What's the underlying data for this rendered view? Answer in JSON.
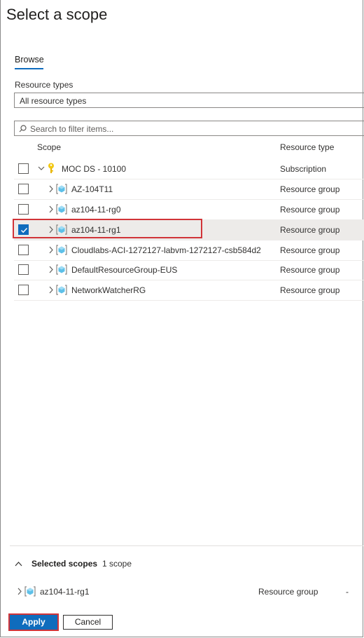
{
  "panel": {
    "title": "Select a scope"
  },
  "tabs": [
    {
      "label": "Browse"
    }
  ],
  "resource_types": {
    "label": "Resource types",
    "value": "All resource types"
  },
  "filter": {
    "placeholder": "Search to filter items..."
  },
  "table": {
    "headers": {
      "scope": "Scope",
      "type": "Resource type"
    },
    "rows": [
      {
        "name": "MOC DS - 10100",
        "type": "Subscription",
        "checked": false,
        "expanded": true,
        "icon": "key-icon"
      },
      {
        "name": "AZ-104T11",
        "type": "Resource group",
        "checked": false,
        "expanded": false,
        "icon": "resource-group-icon"
      },
      {
        "name": "az104-11-rg0",
        "type": "Resource group",
        "checked": false,
        "expanded": false,
        "icon": "resource-group-icon"
      },
      {
        "name": "az104-11-rg1",
        "type": "Resource group",
        "checked": true,
        "expanded": false,
        "icon": "resource-group-icon"
      },
      {
        "name": "Cloudlabs-ACI-1272127-labvm-1272127-csb584d2",
        "type": "Resource group",
        "checked": false,
        "expanded": false,
        "icon": "resource-group-icon"
      },
      {
        "name": "DefaultResourceGroup-EUS",
        "type": "Resource group",
        "checked": false,
        "expanded": false,
        "icon": "resource-group-icon"
      },
      {
        "name": "NetworkWatcherRG",
        "type": "Resource group",
        "checked": false,
        "expanded": false,
        "icon": "resource-group-icon"
      }
    ]
  },
  "selected_scopes": {
    "title": "Selected scopes",
    "count": "1 scope",
    "items": [
      {
        "name": "az104-11-rg1",
        "type": "Resource group",
        "extra": "-"
      }
    ]
  },
  "footer": {
    "apply_label": "Apply",
    "cancel_label": "Cancel"
  },
  "colors": {
    "accent": "#0f6cbd",
    "highlight": "#d13438",
    "rg_icon": "#5ec0e8",
    "key_icon": "#f2c811"
  }
}
